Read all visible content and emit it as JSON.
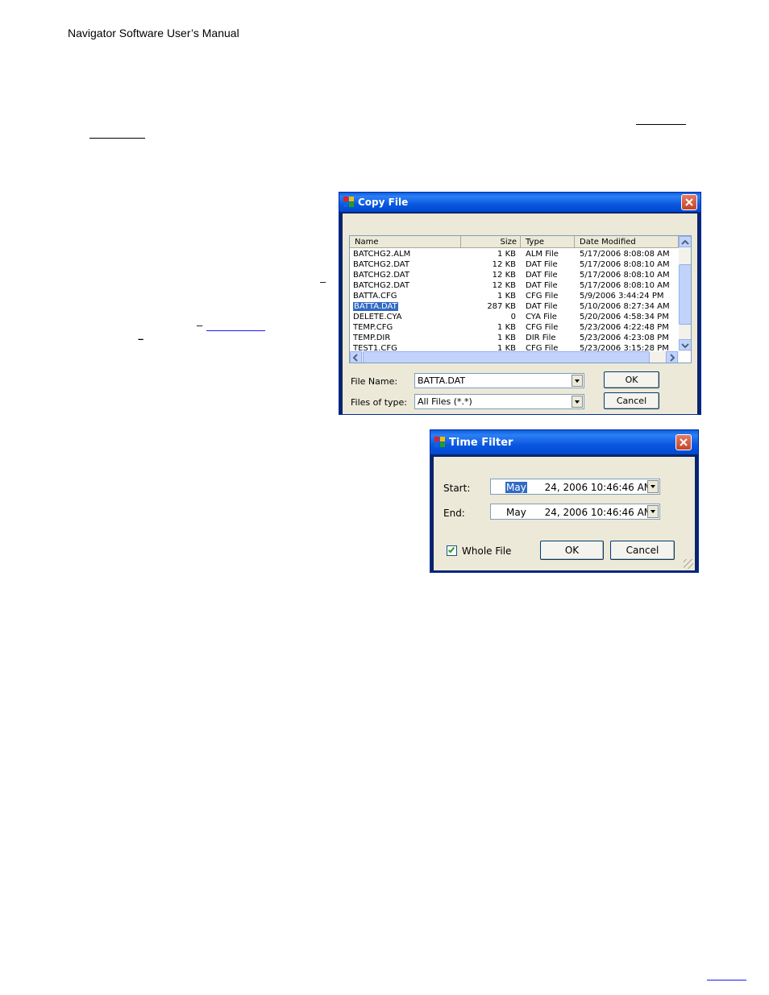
{
  "document": {
    "header": "Navigator Software User’s Manual"
  },
  "copy_file_dialog": {
    "title": "Copy File",
    "columns": [
      "Name",
      "Size",
      "Type",
      "Date Modified"
    ],
    "rows": [
      {
        "name": "BATCHG2.ALM",
        "size": "1 KB",
        "type": "ALM File",
        "date": "5/17/2006 8:08:08 AM"
      },
      {
        "name": "BATCHG2.DAT",
        "size": "12 KB",
        "type": "DAT File",
        "date": "5/17/2006 8:08:10 AM"
      },
      {
        "name": "BATCHG2.DAT",
        "size": "12 KB",
        "type": "DAT File",
        "date": "5/17/2006 8:08:10 AM"
      },
      {
        "name": "BATCHG2.DAT",
        "size": "12 KB",
        "type": "DAT File",
        "date": "5/17/2006 8:08:10 AM"
      },
      {
        "name": "BATTA.CFG",
        "size": "1 KB",
        "type": "CFG File",
        "date": "5/9/2006 3:44:24 PM"
      },
      {
        "name": "BATTA.DAT",
        "size": "287 KB",
        "type": "DAT File",
        "date": "5/10/2006 8:27:34 AM",
        "selected": true
      },
      {
        "name": "DELETE.CYA",
        "size": "0",
        "type": "CYA File",
        "date": "5/20/2006 4:58:34 PM"
      },
      {
        "name": "TEMP.CFG",
        "size": "1 KB",
        "type": "CFG File",
        "date": "5/23/2006 4:22:48 PM"
      },
      {
        "name": "TEMP.DIR",
        "size": "1 KB",
        "type": "DIR File",
        "date": "5/23/2006 4:23:08 PM"
      },
      {
        "name": "TEST1.CFG",
        "size": "1 KB",
        "type": "CFG File",
        "date": "5/23/2006 3:15:28 PM"
      }
    ],
    "file_name_label": "File Name:",
    "file_name_value": "BATTA.DAT",
    "files_of_type_label": "Files of type:",
    "files_of_type_value": "All Files (*.*)",
    "ok_label": "OK",
    "cancel_label": "Cancel"
  },
  "time_filter_dialog": {
    "title": "Time Filter",
    "start_label": "Start:",
    "start_month": "May",
    "start_rest": "24, 2006  10:46:46 AM",
    "end_label": "End:",
    "end_month": "May",
    "end_rest": "24, 2006  10:46:46 AM",
    "whole_file_label": "Whole File",
    "whole_file_checked": true,
    "ok_label": "OK",
    "cancel_label": "Cancel"
  },
  "colors": {
    "titlebar": "#0a58e0",
    "selection": "#316ac5",
    "dialog_face": "#ece9d8",
    "close_button": "#c4442a"
  }
}
